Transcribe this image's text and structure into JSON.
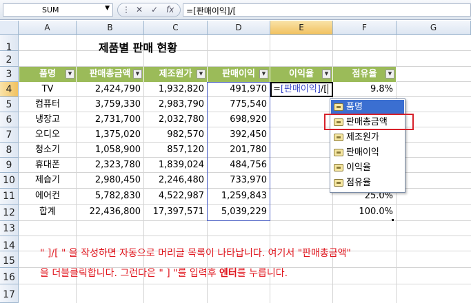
{
  "formula_bar": {
    "name_box": "SUM",
    "cancel_icon": "✕",
    "enter_icon": "✓",
    "fx_label": "fx",
    "formula": "=[판매이익]/["
  },
  "columns": [
    "A",
    "B",
    "C",
    "D",
    "E",
    "F",
    "G"
  ],
  "rows": [
    "1",
    "2",
    "3",
    "4",
    "5",
    "6",
    "7",
    "8",
    "9",
    "10",
    "11",
    "12",
    "13",
    "14",
    "15",
    "16",
    "17"
  ],
  "title": "제품별 판매 현황",
  "table": {
    "headers": [
      "품명",
      "판매총금액",
      "제조원가",
      "판매이익",
      "이익율",
      "점유율"
    ],
    "data": [
      [
        "TV",
        "2,424,790",
        "1,932,820",
        "491,970",
        "",
        "9.8%"
      ],
      [
        "컴퓨터",
        "3,759,330",
        "2,983,790",
        "775,540",
        "",
        ""
      ],
      [
        "냉장고",
        "2,731,700",
        "2,032,780",
        "698,920",
        "",
        ""
      ],
      [
        "오디오",
        "1,375,020",
        "982,570",
        "392,450",
        "",
        ""
      ],
      [
        "청소기",
        "1,058,900",
        "857,120",
        "201,780",
        "",
        ""
      ],
      [
        "휴대폰",
        "2,323,780",
        "1,839,024",
        "484,756",
        "",
        ""
      ],
      [
        "제습기",
        "2,980,450",
        "2,246,480",
        "733,970",
        "",
        ""
      ],
      [
        "에어컨",
        "5,782,830",
        "4,522,987",
        "1,259,843",
        "",
        "25.0%"
      ],
      [
        "합계",
        "22,436,800",
        "17,397,571",
        "5,039,229",
        "",
        "100.0%"
      ]
    ]
  },
  "edit_cell": {
    "prefix": "=",
    "ref": "[판매이익]",
    "suffix": "/["
  },
  "autocomplete": {
    "items": [
      "품명",
      "판매총금액",
      "제조원가",
      "판매이익",
      "이익율",
      "점유율"
    ],
    "selected_index": 0,
    "highlighted_index": 1
  },
  "notes": {
    "line1": "\" ]/[ \" 을 작성하면 자동으로 머리글 목록이 나타납니다. 여기서 \"판매총금액\"",
    "line2_a": "을 더블클릭합니다. 그런다은 \" ] \"를 입력후 ",
    "line2_b": "엔터",
    "line2_c": "를 누릅니다."
  },
  "colors": {
    "header_bg": "#9bbb59",
    "note_text": "#e0161e",
    "highlight": "#d7212a",
    "selection": "#3b6fd1"
  }
}
